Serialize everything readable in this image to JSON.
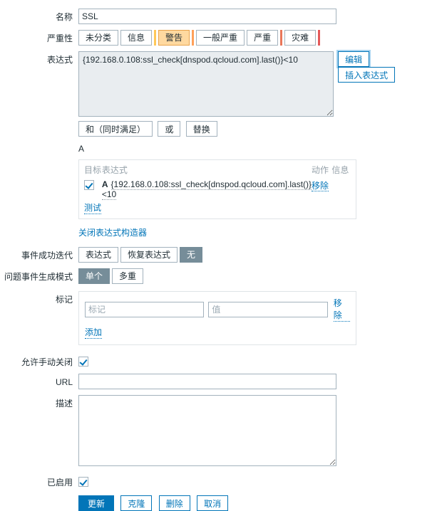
{
  "form": {
    "name": {
      "label": "名称",
      "value": "SSL",
      "placeholder": ""
    },
    "severity": {
      "label": "严重性",
      "options": [
        {
          "label": "未分类",
          "selected": false,
          "color": "#97aab3"
        },
        {
          "label": "信息",
          "selected": false,
          "color": "#7499ff"
        },
        {
          "label": "警告",
          "selected": true,
          "color": "#ffc859"
        },
        {
          "label": "一般严重",
          "selected": false,
          "color": "#ffa059"
        },
        {
          "label": "严重",
          "selected": false,
          "color": "#e97659"
        },
        {
          "label": "灾难",
          "selected": false,
          "color": "#e45959"
        }
      ],
      "selected_value": "警告"
    },
    "expression": {
      "label": "表达式",
      "value": "{192.168.0.108:ssl_check[dnspod.qcloud.com].last()}<10",
      "edit_button": "编辑",
      "insert_button": "插入表达式",
      "operators": {
        "and": "和（同时满足）",
        "or": "或",
        "replace": "替换"
      },
      "constructor_letter": "A"
    },
    "builder": {
      "headers": {
        "target": "目标",
        "expression": "表达式",
        "action": "动作",
        "info": "信息"
      },
      "rows": [
        {
          "checked": true,
          "tag": "A",
          "expression": "{192.168.0.108:ssl_check[dnspod.qcloud.com].last()}<10",
          "action": "移除",
          "info": ""
        }
      ],
      "test_link": "测试",
      "close_link": "关闭表达式构造器"
    },
    "ok_event_closes": {
      "label": "事件成功迭代",
      "options": [
        "表达式",
        "恢复表达式",
        "无"
      ],
      "selected": "无"
    },
    "problem_event_generation": {
      "label": "问题事件生成模式",
      "options": [
        "单个",
        "多重"
      ],
      "selected": "单个"
    },
    "tags": {
      "label": "标记",
      "rows": [
        {
          "key_value": "",
          "key_placeholder": "标记",
          "value_value": "",
          "value_placeholder": "值",
          "remove_label": "移除"
        }
      ],
      "add_label": "添加"
    },
    "allow_manual_close": {
      "label": "允许手动关闭",
      "checked": true
    },
    "url": {
      "label": "URL",
      "value": "",
      "placeholder": ""
    },
    "description": {
      "label": "描述",
      "value": "",
      "placeholder": ""
    },
    "enabled": {
      "label": "已启用",
      "checked": true
    },
    "footer": {
      "update": "更新",
      "clone": "克隆",
      "delete": "删除",
      "cancel": "取消"
    }
  },
  "theme": {
    "accent": "#0275b8",
    "selected_toggle_bg": "#768d99",
    "warning_bg": "#ffd9a0",
    "border": "#a3b2bd",
    "panel_border": "#dfe4e7",
    "expr_bg": "#e9edf0",
    "muted_text": "#97a3ab"
  }
}
